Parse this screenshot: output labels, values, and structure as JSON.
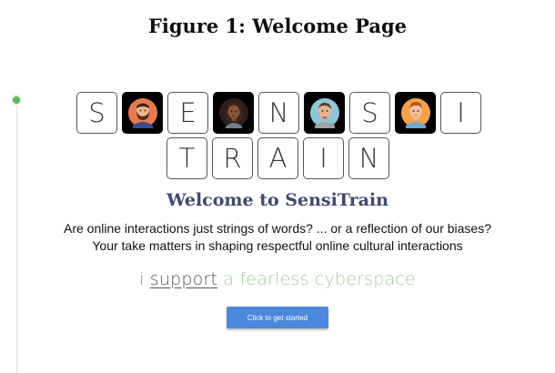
{
  "figure_caption": "Figure 1: Welcome Page",
  "logo": {
    "row1": [
      {
        "type": "letter",
        "char": "S"
      },
      {
        "type": "avatar",
        "icon": "bearded-man-avatar"
      },
      {
        "type": "letter",
        "char": "E"
      },
      {
        "type": "avatar",
        "icon": "dark-skinned-woman-avatar"
      },
      {
        "type": "letter",
        "char": "N"
      },
      {
        "type": "avatar",
        "icon": "man-with-goatee-avatar"
      },
      {
        "type": "letter",
        "char": "S"
      },
      {
        "type": "avatar",
        "icon": "ginger-man-avatar"
      },
      {
        "type": "letter",
        "char": "I"
      }
    ],
    "row2": [
      "T",
      "R",
      "A",
      "I",
      "N"
    ]
  },
  "welcome_title": "Welcome to SensiTrain",
  "tagline_line1": "Are online interactions just strings of words? ... or a reflection of our biases?",
  "tagline_line2": "Your take matters in shaping respectful online cultural interactions",
  "slogan": {
    "part1": "i",
    "part2": "support",
    "part3": "a fearless cyberspace"
  },
  "start_button_label": "Click to get started",
  "colors": {
    "title": "#3e4a72",
    "slogan_accent": "#9ed193",
    "button": "#4a89dc",
    "timeline_dot": "#5cb85c"
  }
}
